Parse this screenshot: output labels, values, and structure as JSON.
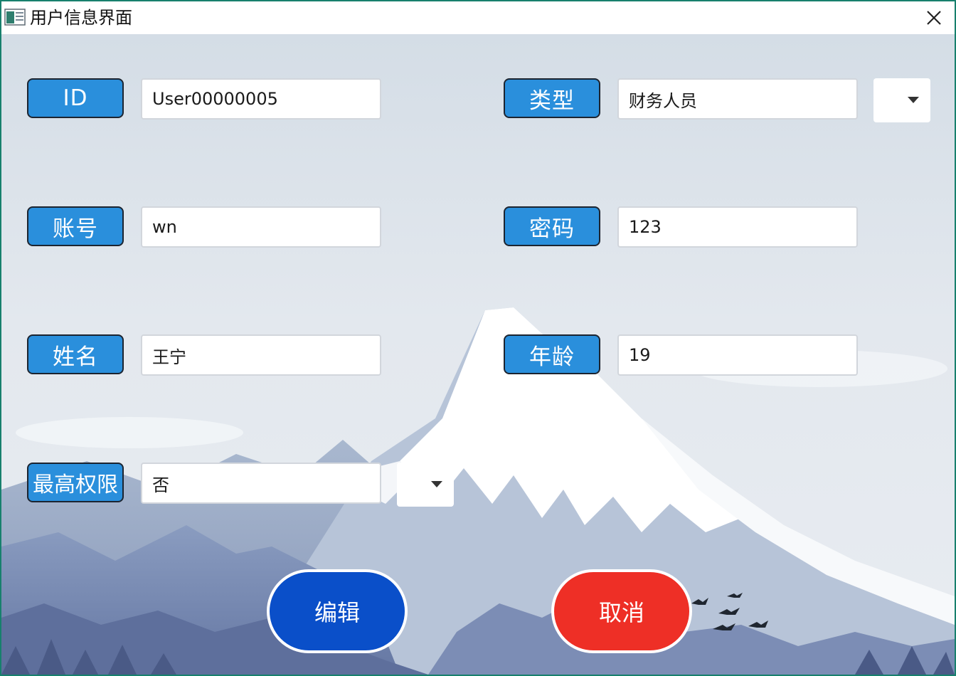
{
  "window": {
    "title": "用户信息界面",
    "icon": "app-window-icon",
    "close_icon": "close-icon"
  },
  "form": {
    "id": {
      "label": "ID",
      "value": "User00000005"
    },
    "type": {
      "label": "类型",
      "value": "财务人员",
      "dropdown_icon": "caret-down-icon"
    },
    "account": {
      "label": "账号",
      "value": "wn"
    },
    "password": {
      "label": "密码",
      "value": "123"
    },
    "name": {
      "label": "姓名",
      "value": "王宁"
    },
    "age": {
      "label": "年龄",
      "value": "19"
    },
    "admin": {
      "label": "最高权限",
      "value": "否",
      "dropdown_icon": "caret-down-icon"
    }
  },
  "actions": {
    "edit_label": "编辑",
    "cancel_label": "取消"
  },
  "colors": {
    "label_bg": "#2a8fdc",
    "edit_button": "#0a4fc9",
    "cancel_button": "#ee2f26",
    "window_border": "#17806d"
  },
  "background": "mountain-landscape-with-birds"
}
